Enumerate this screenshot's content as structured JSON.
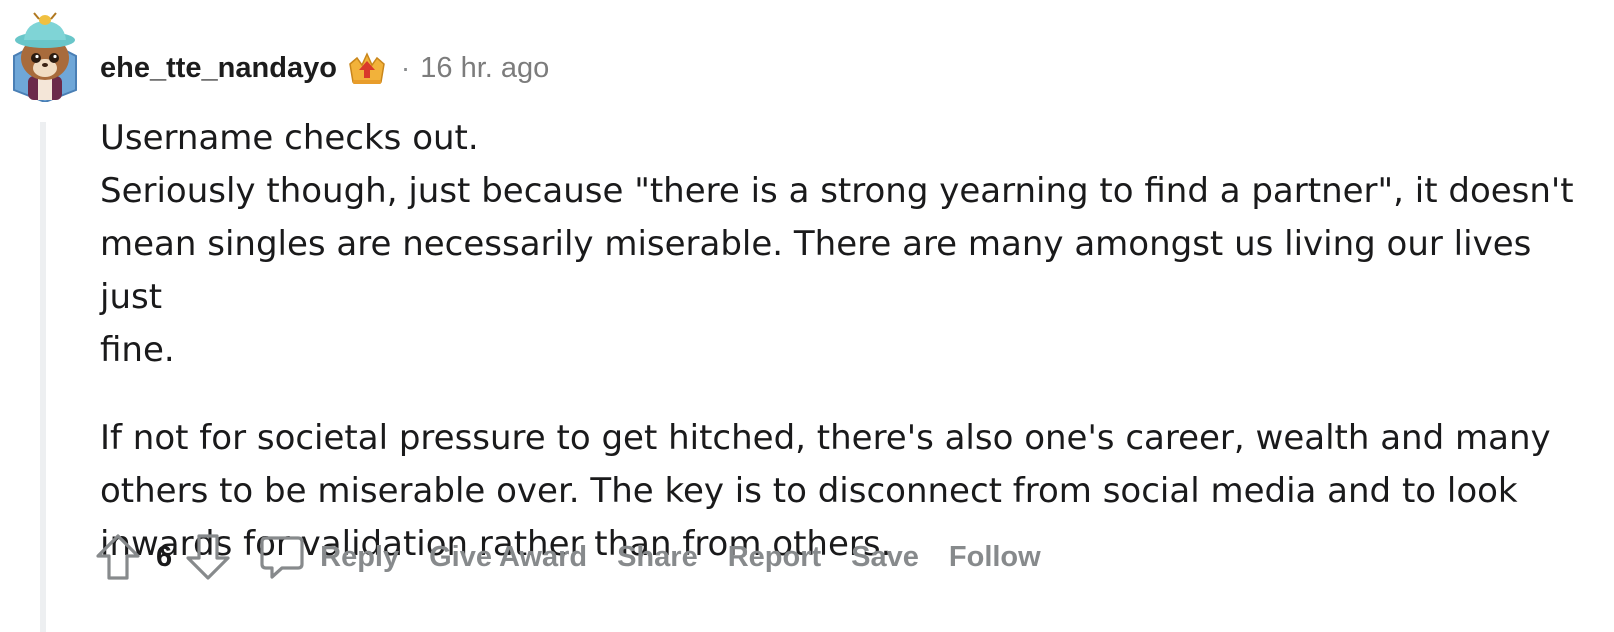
{
  "comment": {
    "author": "ehe_tte_nandayo",
    "flair_icon": "crown-flair-icon",
    "separator": "·",
    "timestamp": "16 hr. ago",
    "body": {
      "paragraph_1": [
        "Username checks out.",
        "Seriously though, just because \"there is a strong yearning to find a partner\", it doesn't",
        "mean singles are necessarily miserable. There are many amongst us living our lives just",
        "fine."
      ],
      "paragraph_2": [
        "If not for societal pressure to get hitched, there's also one's career, wealth and many",
        "others to be miserable over. The key is to disconnect from social media and to look",
        "inwards for validation rather than from others."
      ]
    },
    "score": "6",
    "actions": {
      "reply": "Reply",
      "give_award": "Give Award",
      "share": "Share",
      "report": "Report",
      "save": "Save",
      "follow": "Follow"
    }
  },
  "colors": {
    "text": "#1a1a1b",
    "muted": "#878a8c",
    "thread_line": "#edeff1",
    "flair_gold": "#f2b23a",
    "flair_red": "#d93a2b"
  }
}
